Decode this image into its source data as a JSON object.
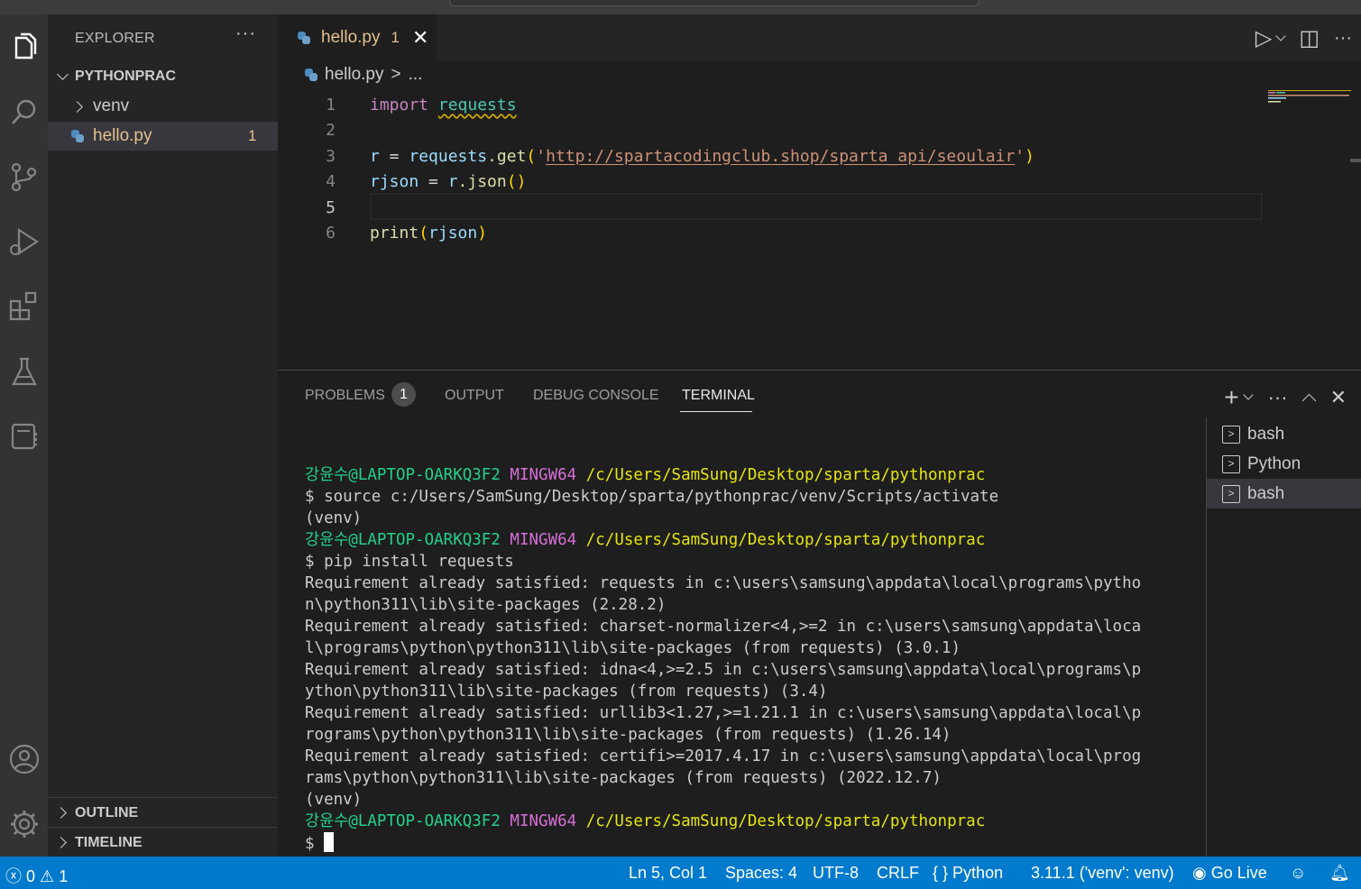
{
  "sidebar": {
    "title": "EXPLORER",
    "more": "···",
    "folder": "PYTHONPRAC",
    "items": [
      {
        "label": "venv"
      },
      {
        "label": "hello.py",
        "badge": "1"
      }
    ],
    "outline": "OUTLINE",
    "timeline": "TIMELINE"
  },
  "tab": {
    "label": "hello.py",
    "badge": "1",
    "close": "✕"
  },
  "toolbar": {
    "run": "▷",
    "split": "◫",
    "more": "···"
  },
  "breadcrumb": {
    "file": "hello.py",
    "sep": ">",
    "rest": "..."
  },
  "editor": {
    "current_line": 5,
    "lines": [
      {
        "num": "1"
      },
      {
        "num": "2"
      },
      {
        "num": "3"
      },
      {
        "num": "4"
      },
      {
        "num": "5"
      },
      {
        "num": "6"
      }
    ],
    "code": {
      "l1_kw": "import",
      "l1_mod": "requests",
      "l3_var": "r",
      "l3_eq": " = ",
      "l3_mod": "requests",
      "l3_fn": ".get",
      "l3_url": "http://spartacodingclub.shop/sparta_api/seoulair",
      "l4_var": "rjson",
      "l4_eq": " = ",
      "l4_var2": "r",
      "l4_fn": ".json",
      "l6_fn": "print",
      "l6_arg": "rjson"
    }
  },
  "panel": {
    "tabs": [
      {
        "label": "PROBLEMS",
        "badge": "1"
      },
      {
        "label": "OUTPUT"
      },
      {
        "label": "DEBUG CONSOLE"
      },
      {
        "label": "TERMINAL"
      }
    ],
    "active_tab": "TERMINAL",
    "actions": {
      "add": "+",
      "dropdown": "⌄",
      "more": "···",
      "maximize": "⌃",
      "close": "✕"
    },
    "terminals": [
      {
        "label": "bash"
      },
      {
        "label": "Python"
      },
      {
        "label": "bash"
      }
    ]
  },
  "terminal": {
    "prompt_user": "강윤수@LAPTOP-OARKQ3F2",
    "prompt_sys": "MINGW64",
    "prompt_path": "/c/Users/SamSung/Desktop/sparta/pythonprac",
    "cmd1": "$ source c:/Users/SamSung/Desktop/sparta/pythonprac/venv/Scripts/activate",
    "venv": "(venv)",
    "cmd2": "$ pip install requests",
    "out1a": "Requirement already satisfied: requests in c:\\users\\samsung\\appdata\\local\\programs\\pytho",
    "out1b": "n\\python311\\lib\\site-packages (2.28.2)",
    "out2a": "Requirement already satisfied: charset-normalizer<4,>=2 in c:\\users\\samsung\\appdata\\loca",
    "out2b": "l\\programs\\python\\python311\\lib\\site-packages (from requests) (3.0.1)",
    "out3a": "Requirement already satisfied: idna<4,>=2.5 in c:\\users\\samsung\\appdata\\local\\programs\\p",
    "out3b": "ython\\python311\\lib\\site-packages (from requests) (3.4)",
    "out4a": "Requirement already satisfied: urllib3<1.27,>=1.21.1 in c:\\users\\samsung\\appdata\\local\\p",
    "out4b": "rograms\\python\\python311\\lib\\site-packages (from requests) (1.26.14)",
    "out5a": "Requirement already satisfied: certifi>=2017.4.17 in c:\\users\\samsung\\appdata\\local\\prog",
    "out5b": "rams\\python\\python311\\lib\\site-packages (from requests) (2022.12.7)",
    "dollar": "$ "
  },
  "statusbar": {
    "errors": "0",
    "warnings": "1",
    "position": "Ln 5, Col 1",
    "spaces": "Spaces: 4",
    "encoding": "UTF-8",
    "eol": "CRLF",
    "language": "Python",
    "interpreter": "3.11.1 ('venv': venv)",
    "golive": "Go Live"
  },
  "colors": {
    "statusbar": "#007acc",
    "activity": "#333333",
    "sidebar": "#252526",
    "editor": "#1e1e1e",
    "modified": "#e2c08d"
  },
  "icons": [
    "explorer-icon",
    "search-icon",
    "source-control-icon",
    "run-debug-icon",
    "extensions-icon",
    "testing-icon",
    "remote-explorer-icon",
    "account-icon",
    "settings-gear-icon"
  ]
}
